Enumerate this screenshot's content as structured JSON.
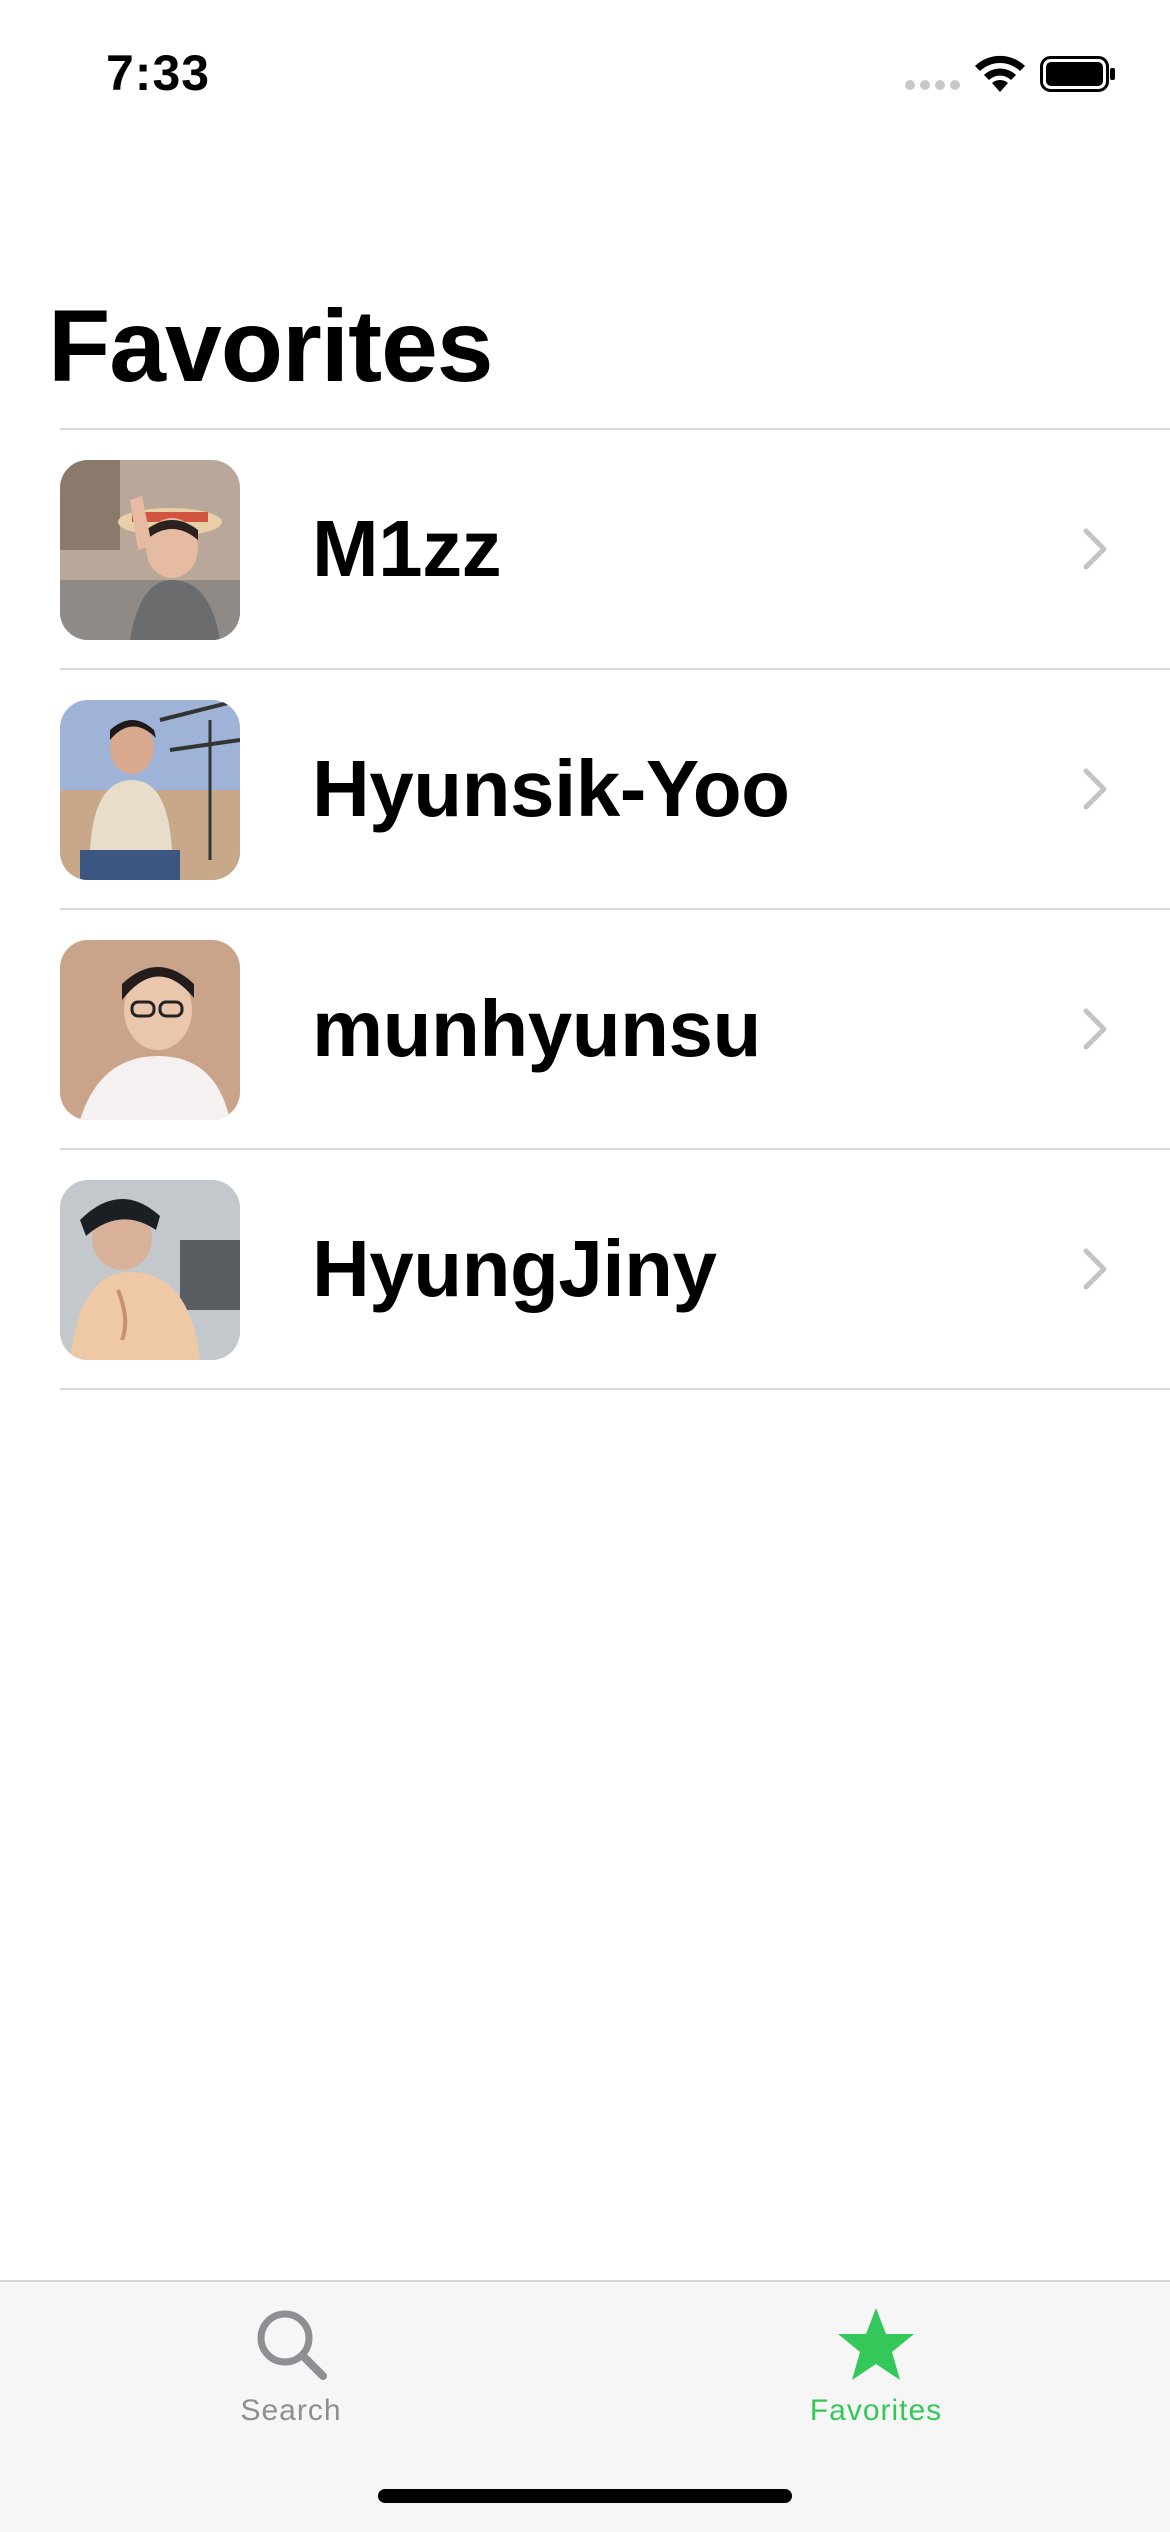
{
  "status_bar": {
    "time": "7:33",
    "icons": [
      "signal-dots-icon",
      "wifi-icon",
      "battery-icon"
    ]
  },
  "page": {
    "title": "Favorites"
  },
  "favorites": [
    {
      "name": "M1zz",
      "avatar": "avatar-photo",
      "accessory": "chevron-right-icon"
    },
    {
      "name": "Hyunsik-Yoo",
      "avatar": "avatar-photo",
      "accessory": "chevron-right-icon"
    },
    {
      "name": "munhyunsu",
      "avatar": "avatar-photo",
      "accessory": "chevron-right-icon"
    },
    {
      "name": "HyungJiny",
      "avatar": "avatar-photo",
      "accessory": "chevron-right-icon"
    }
  ],
  "tab_bar": {
    "tabs": [
      {
        "label": "Search",
        "icon": "magnifying-glass-icon",
        "selected": false
      },
      {
        "label": "Favorites",
        "icon": "star-icon",
        "selected": true
      }
    ],
    "active_color": "#34c759",
    "inactive_color": "#8e8e93"
  },
  "colors": {
    "background": "#ffffff",
    "tab_bar_background": "#f6f6f6",
    "separator": "#d8d8dc",
    "chevron": "#c4c4c7"
  }
}
